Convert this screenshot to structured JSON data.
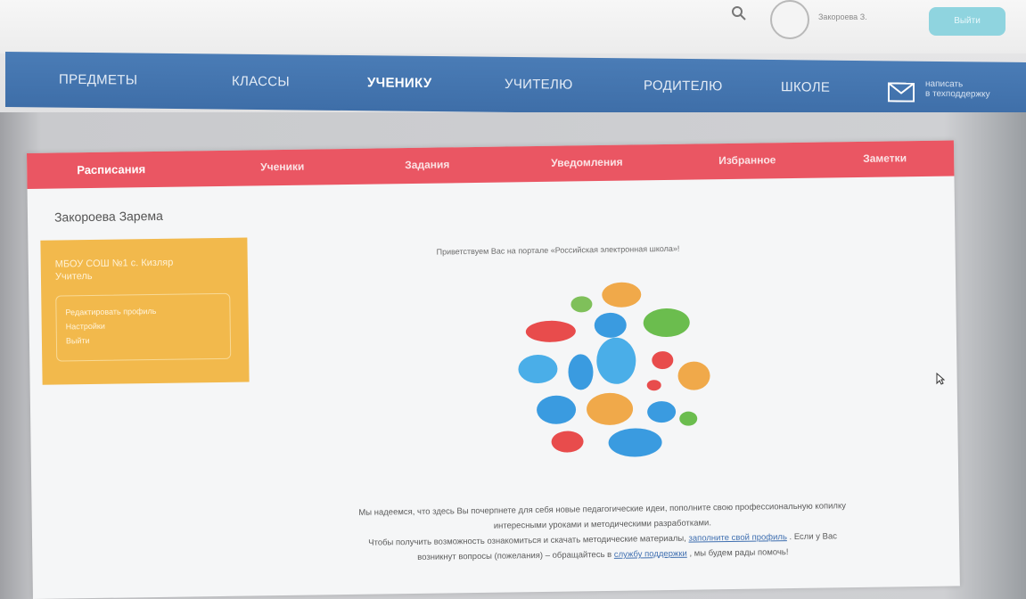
{
  "header": {
    "username": "Закороева З.",
    "login_button": "Выйти"
  },
  "main_nav": {
    "items": [
      "ПРЕДМЕТЫ",
      "КЛАССЫ",
      "УЧЕНИКУ",
      "УЧИТЕЛЮ",
      "РОДИТЕЛЮ",
      "ШКОЛЕ"
    ],
    "active": "УЧЕНИКУ",
    "support_line1": "написать",
    "support_line2": "в техподдержку",
    "nav_color": "#4a7cb6"
  },
  "sub_nav": {
    "items": [
      "Расписания",
      "Ученики",
      "Задания",
      "Уведомления",
      "Избранное",
      "Заметки"
    ],
    "nav_color": "#ea5663"
  },
  "profile": {
    "name": "Закороева Зарема",
    "school": "МБОУ СОШ №1 с. Кизляр",
    "role": "Учитель",
    "menu": [
      "Редактировать профиль",
      "Настройки",
      "Выйти"
    ],
    "card_color": "#f2b94c"
  },
  "welcome_text": "Приветствуем Вас на портале «Российская электронная школа»!",
  "illustration_icon": "speech-bubbles-illustration",
  "bottom": {
    "line1": "Мы надеемся, что здесь Вы почерпнете для себя новые педагогические идеи, пополните свою профессиональную копилку",
    "line2": "интересными уроками и методическими разработками.",
    "line3_a": "Чтобы получить возможность ознакомиться и скачать методические материалы,",
    "line3_link": "заполните свой профиль",
    "line3_b": ". Если у Вас",
    "line4_a": "возникнут вопросы (пожелания) – обращайтесь в",
    "line4_link": "службу поддержки",
    "line4_b": ", мы будем рады помочь!"
  }
}
